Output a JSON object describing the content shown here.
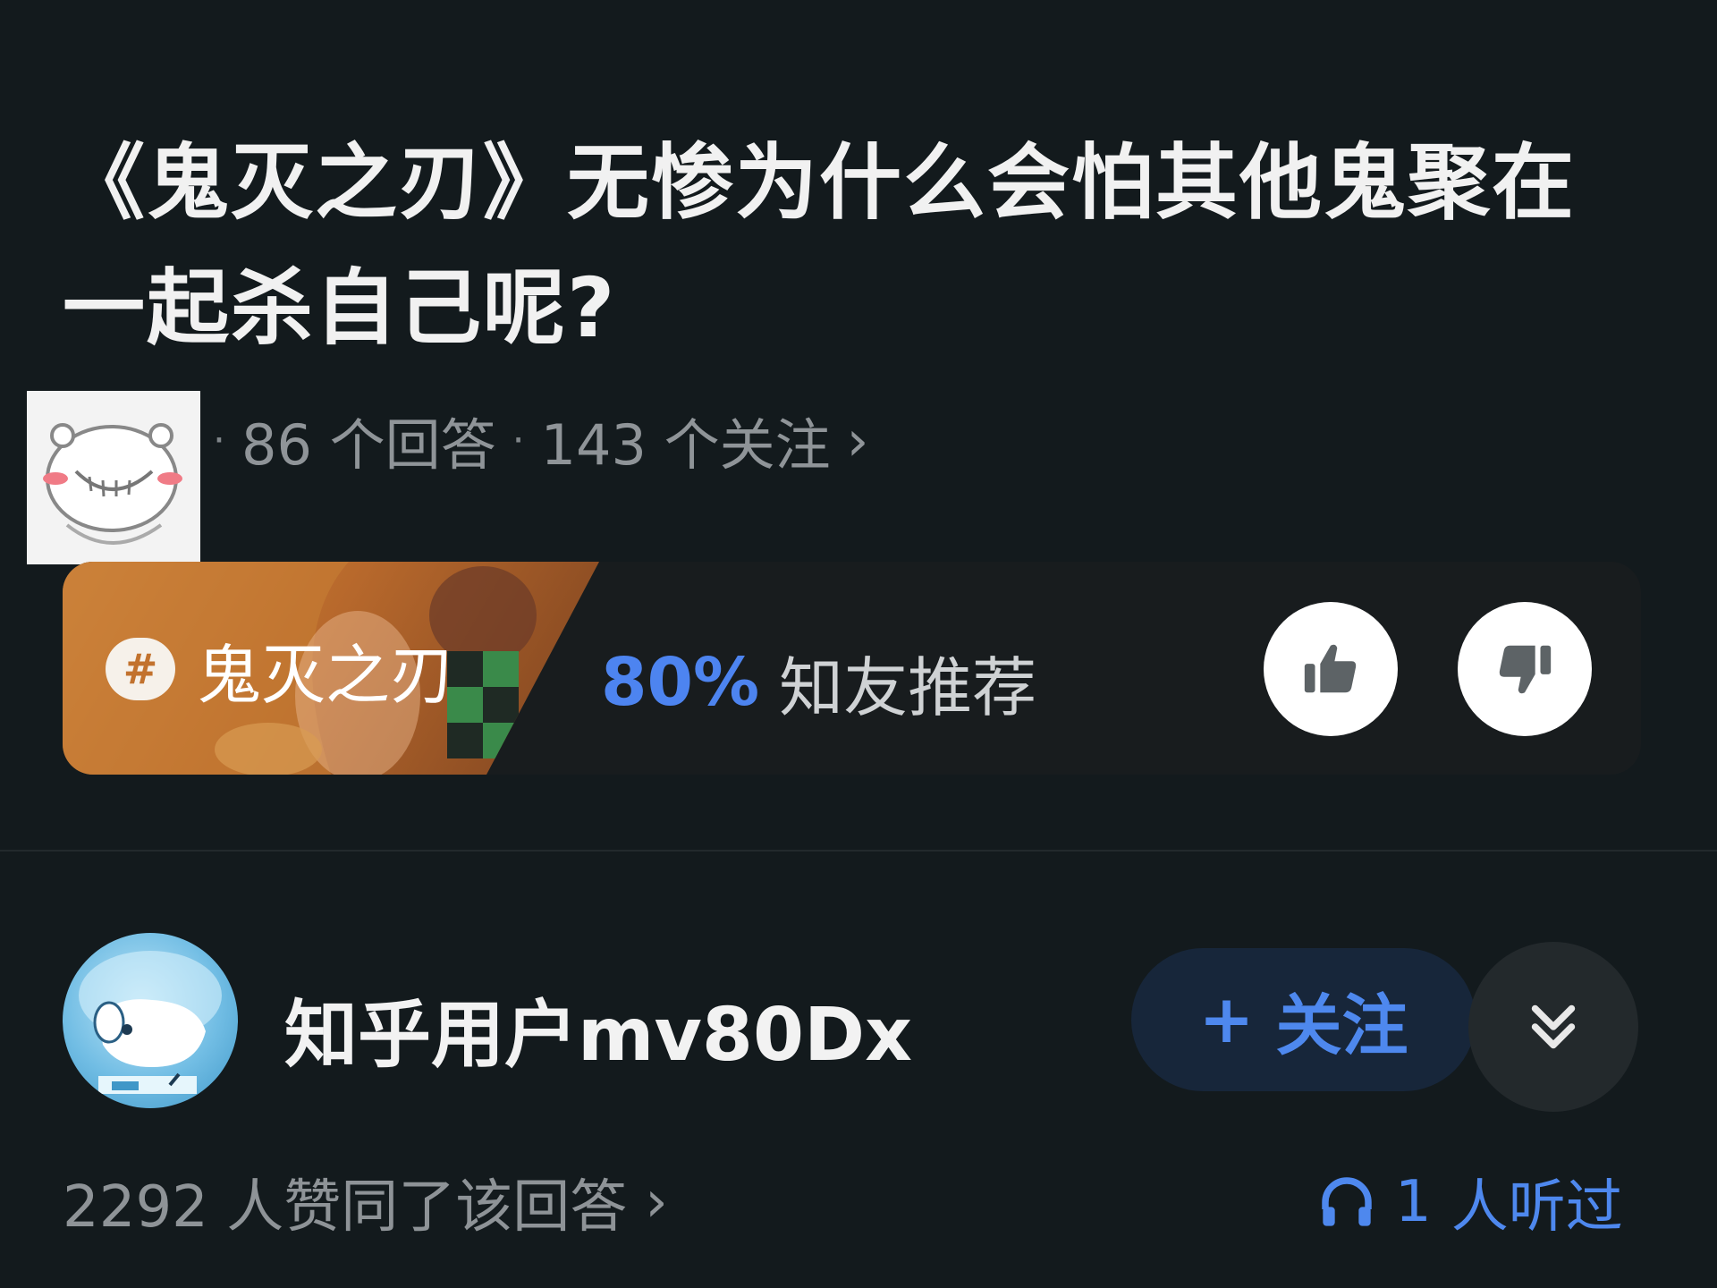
{
  "question": {
    "title": "《鬼灭之刃》无惨为什么会怕其他鬼聚在一起杀自己呢?",
    "answers_count": "86 个回答",
    "followers_count": "143 个关注",
    "separator": "·",
    "more_icon": "chevron-right-icon"
  },
  "topic": {
    "hash_symbol": "#",
    "name": "鬼灭之刃",
    "recommend_percent": "80%",
    "recommend_label": "知友推荐",
    "like_icon": "thumbs-up-icon",
    "dislike_icon": "thumbs-down-icon",
    "accent_color": "#4d84f0"
  },
  "answer": {
    "author_name": "知乎用户mv80Dx",
    "follow_plus": "+",
    "follow_label": "关注",
    "collapse_icon": "double-chevron-down-icon",
    "likes_text": "2292 人赞同了该回答",
    "likes_chevron": "›",
    "listened_count": "1",
    "listened_label": "人听过",
    "listen_icon": "headphones-icon"
  }
}
